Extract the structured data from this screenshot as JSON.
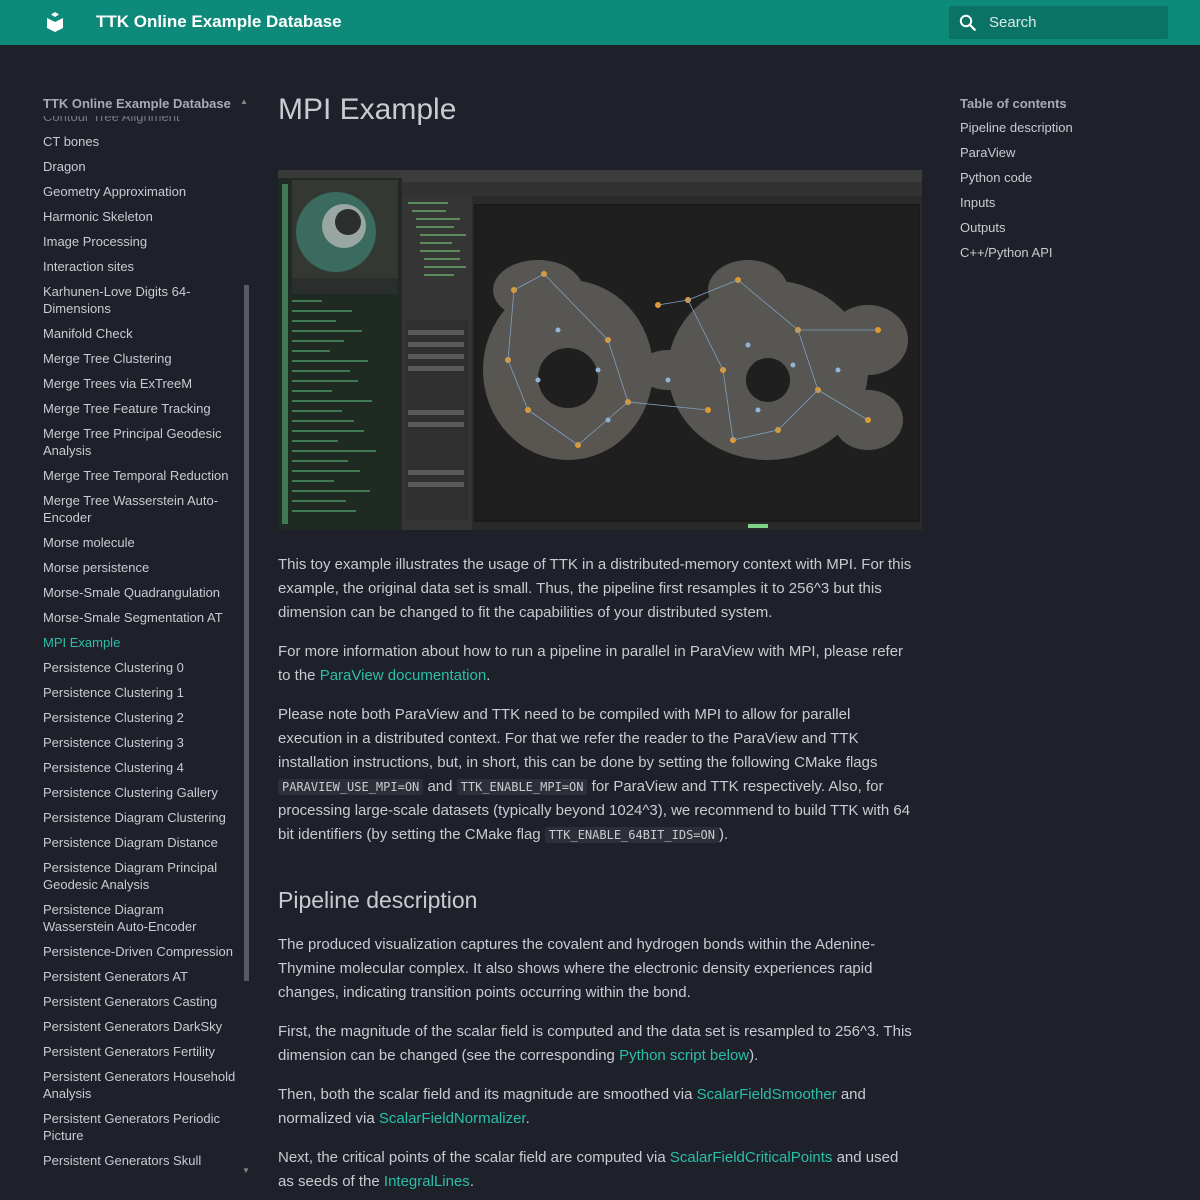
{
  "header": {
    "site_title": "TTK Online Example Database",
    "search_placeholder": "Search"
  },
  "sidebar": {
    "title": "TTK Online Example Database",
    "items": [
      {
        "label": "Contour Tree Alignment",
        "state": "cut"
      },
      {
        "label": "CT bones"
      },
      {
        "label": "Dragon"
      },
      {
        "label": "Geometry Approximation"
      },
      {
        "label": "Harmonic Skeleton"
      },
      {
        "label": "Image Processing"
      },
      {
        "label": "Interaction sites"
      },
      {
        "label": "Karhunen-Love Digits 64-Dimensions"
      },
      {
        "label": "Manifold Check"
      },
      {
        "label": "Merge Tree Clustering"
      },
      {
        "label": "Merge Trees via ExTreeM"
      },
      {
        "label": "Merge Tree Feature Tracking"
      },
      {
        "label": "Merge Tree Principal Geodesic Analysis"
      },
      {
        "label": "Merge Tree Temporal Reduction"
      },
      {
        "label": "Merge Tree Wasserstein Auto-Encoder"
      },
      {
        "label": "Morse molecule"
      },
      {
        "label": "Morse persistence"
      },
      {
        "label": "Morse-Smale Quadrangulation"
      },
      {
        "label": "Morse-Smale Segmentation AT"
      },
      {
        "label": "MPI Example",
        "state": "active"
      },
      {
        "label": "Persistence Clustering 0"
      },
      {
        "label": "Persistence Clustering 1"
      },
      {
        "label": "Persistence Clustering 2"
      },
      {
        "label": "Persistence Clustering 3"
      },
      {
        "label": "Persistence Clustering 4"
      },
      {
        "label": "Persistence Clustering Gallery"
      },
      {
        "label": "Persistence Diagram Clustering"
      },
      {
        "label": "Persistence Diagram Distance"
      },
      {
        "label": "Persistence Diagram Principal Geodesic Analysis"
      },
      {
        "label": "Persistence Diagram Wasserstein Auto-Encoder"
      },
      {
        "label": "Persistence-Driven Compression"
      },
      {
        "label": "Persistent Generators AT"
      },
      {
        "label": "Persistent Generators Casting"
      },
      {
        "label": "Persistent Generators DarkSky"
      },
      {
        "label": "Persistent Generators Fertility"
      },
      {
        "label": "Persistent Generators Household Analysis"
      },
      {
        "label": "Persistent Generators Periodic Picture"
      },
      {
        "label": "Persistent Generators Skull"
      }
    ]
  },
  "main": {
    "title": "MPI Example",
    "intro": "This toy example illustrates the usage of TTK in a distributed-memory context with MPI. For this example, the original data set is small. Thus, the pipeline first resamples it to 256^3 but this dimension can be changed to fit the capabilities of your distributed system.",
    "p2": {
      "before": "For more information about how to run a pipeline in parallel in ParaView with MPI, please refer to the ",
      "link": "ParaView documentation",
      "after": "."
    },
    "p3": {
      "t1": "Please note both ParaView and TTK need to be compiled with MPI to allow for parallel execution in a distributed context. For that we refer the reader to the ParaView and TTK installation instructions, but, in short, this can be done by setting the following CMake flags ",
      "code1": "PARAVIEW_USE_MPI=ON",
      "t2": " and ",
      "code2": "TTK_ENABLE_MPI=ON",
      "t3": " for ParaView and TTK respectively. Also, for processing large-scale datasets (typically beyond 1024^3), we recommend to build TTK with 64 bit identifiers (by setting the CMake flag ",
      "code3": "TTK_ENABLE_64BIT_IDS=ON",
      "t4": ")."
    },
    "section_title": "Pipeline description",
    "p4": "The produced visualization captures the covalent and hydrogen bonds within the Adenine-Thymine molecular complex. It also shows where the electronic density experiences rapid changes, indicating transition points occurring within the bond.",
    "p5": {
      "before": "First, the magnitude of the scalar field is computed and the data set is resampled to 256^3. This dimension can be changed (see the corresponding ",
      "link": "Python script below",
      "after": ")."
    },
    "p6": {
      "t1": "Then, both the scalar field and its magnitude are smoothed via ",
      "link1": "ScalarFieldSmoother",
      "t2": " and normalized via ",
      "link2": "ScalarFieldNormalizer",
      "t3": "."
    },
    "p7": {
      "t1": "Next, the critical points of the scalar field are computed via ",
      "link1": "ScalarFieldCriticalPoints",
      "t2": " and used as seeds of the ",
      "link2": "IntegralLines",
      "t3": "."
    }
  },
  "toc": {
    "title": "Table of contents",
    "items": [
      "Pipeline description",
      "ParaView",
      "Python code",
      "Inputs",
      "Outputs",
      "C++/Python API"
    ]
  },
  "colors": {
    "header_bg": "#0d8a7a",
    "accent": "#2bbfa9",
    "page_bg": "#1e2129",
    "text": "#c9cbd2"
  }
}
